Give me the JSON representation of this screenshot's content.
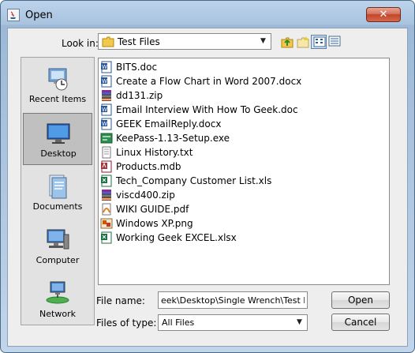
{
  "window": {
    "title": "Open",
    "close_label": "✕"
  },
  "toolbar": {
    "lookin_label": "Look in:",
    "lookin_value": "Test Files",
    "buttons": [
      "up-one-level-icon",
      "new-folder-icon",
      "list-view-icon",
      "details-view-icon"
    ]
  },
  "places": [
    {
      "label": "Recent Items",
      "icon": "recent-items-icon",
      "selected": false
    },
    {
      "label": "Desktop",
      "icon": "desktop-icon",
      "selected": true
    },
    {
      "label": "Documents",
      "icon": "documents-icon",
      "selected": false
    },
    {
      "label": "Computer",
      "icon": "computer-icon",
      "selected": false
    },
    {
      "label": "Network",
      "icon": "network-icon",
      "selected": false
    }
  ],
  "files": [
    {
      "name": "BITS.doc",
      "type": "word"
    },
    {
      "name": "Create a Flow Chart in Word 2007.docx",
      "type": "word"
    },
    {
      "name": "dd131.zip",
      "type": "zip"
    },
    {
      "name": "Email Interview With How To Geek.doc",
      "type": "word"
    },
    {
      "name": "GEEK EmailReply.docx",
      "type": "word"
    },
    {
      "name": "KeePass-1.13-Setup.exe",
      "type": "exe"
    },
    {
      "name": "Linux History.txt",
      "type": "text"
    },
    {
      "name": "Products.mdb",
      "type": "access"
    },
    {
      "name": "Tech_Company Customer List.xls",
      "type": "excel"
    },
    {
      "name": "viscd400.zip",
      "type": "zip"
    },
    {
      "name": "WIKI GUIDE.pdf",
      "type": "pdf"
    },
    {
      "name": "Windows XP.png",
      "type": "image"
    },
    {
      "name": "Working Geek EXCEL.xlsx",
      "type": "excel"
    }
  ],
  "form": {
    "filename_label": "File name:",
    "filename_value": "eek\\Desktop\\Single Wrench\\Test Files",
    "filetype_label": "Files of type:",
    "filetype_value": "All Files",
    "open_label": "Open",
    "cancel_label": "Cancel"
  }
}
